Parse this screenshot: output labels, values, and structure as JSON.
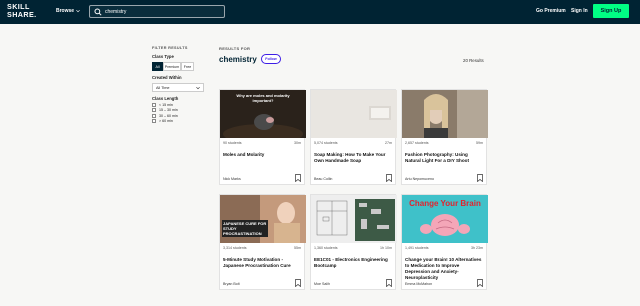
{
  "header": {
    "logo_line1": "SKILL",
    "logo_line2": "SHARE.",
    "browse_label": "Browse",
    "search_value": "chemistry",
    "premium_label": "Go Premium",
    "signin_label": "Sign In",
    "signup_label": "Sign Up"
  },
  "filters": {
    "title": "FILTER RESULTS",
    "class_type": {
      "heading": "Class Type",
      "options": [
        "All",
        "Premium",
        "Free"
      ],
      "selected": "All"
    },
    "created_within": {
      "heading": "Created Within",
      "selected": "All Time"
    },
    "class_length": {
      "heading": "Class Length",
      "options": [
        "< 15 min",
        "15 – 30 min",
        "30 – 60 min",
        "> 60 min"
      ]
    }
  },
  "results": {
    "label": "RESULTS FOR",
    "query": "chemistry",
    "follow_label": "Follow",
    "count": "20 Results"
  },
  "cards": [
    {
      "students": "90 students",
      "duration": "30m",
      "title": "Moles and Molarity",
      "author": "Nick Marks",
      "thumb_text": "Why are moles and molarity important?"
    },
    {
      "students": "5,074 students",
      "duration": "27m",
      "title": "Soap Making: How To Make Your Own Handmade Soap",
      "author": "Beau Collin",
      "thumb_text": ""
    },
    {
      "students": "2,657 students",
      "duration": "59m",
      "title": "Fashion Photography: Using Natural Light For a DIY Shoot",
      "author": "Artu Nepomuceno",
      "thumb_text": ""
    },
    {
      "students": "3,314 students",
      "duration": "55m",
      "title": "5-Minute Study Motivation - Japanese Procrastination Cure",
      "author": "Bryan Bolt",
      "thumb_text": "JAPANESE CURE FOR STUDY PROCRASTINATION"
    },
    {
      "students": "1,360 students",
      "duration": "1h 10m",
      "title": "EE1C01 - Electronics Engineering Bootcamp",
      "author": "Moe Salih",
      "thumb_text": ""
    },
    {
      "students": "1,491 students",
      "duration": "3h 23m",
      "title": "Change your Brain! 10 Alternatives to Medication to Improve Depression and Anxiety- Neuroplasticity",
      "author": "Emma McMahon",
      "thumb_text": "Change Your Brain"
    }
  ],
  "colors": {
    "nav_bg": "#002333",
    "signup_bg": "#00ff84",
    "follow_accent": "#3d1de6"
  }
}
